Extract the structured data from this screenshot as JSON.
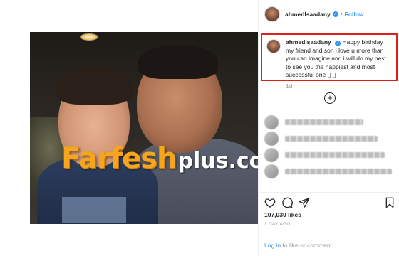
{
  "post": {
    "username": "ahmedlsaadany",
    "follow_label": "Follow",
    "separator": "•",
    "verified_glyph": "✓",
    "caption": "Happy birthday my friend and son i love u more than you can imagine and i will do my best to see you the happiest and most successful one",
    "caption_emoji": "▯ ▯",
    "time_ago": "1d",
    "likes": "107,030 likes",
    "date": "1 DAY AGO",
    "add_comment_glyph": "+"
  },
  "watermark": {
    "main": "Farfesh",
    "sub": "plus.com"
  },
  "footer": {
    "login_label": "Log in",
    "rest_text": " to like or comment."
  },
  "colors": {
    "accent": "#3897f0",
    "highlight_border": "#e0201a",
    "watermark_orange": "#f6a51f"
  },
  "icons": [
    "heart-icon",
    "comment-icon",
    "share-icon",
    "bookmark-icon",
    "verified-icon",
    "add-comment-icon"
  ]
}
